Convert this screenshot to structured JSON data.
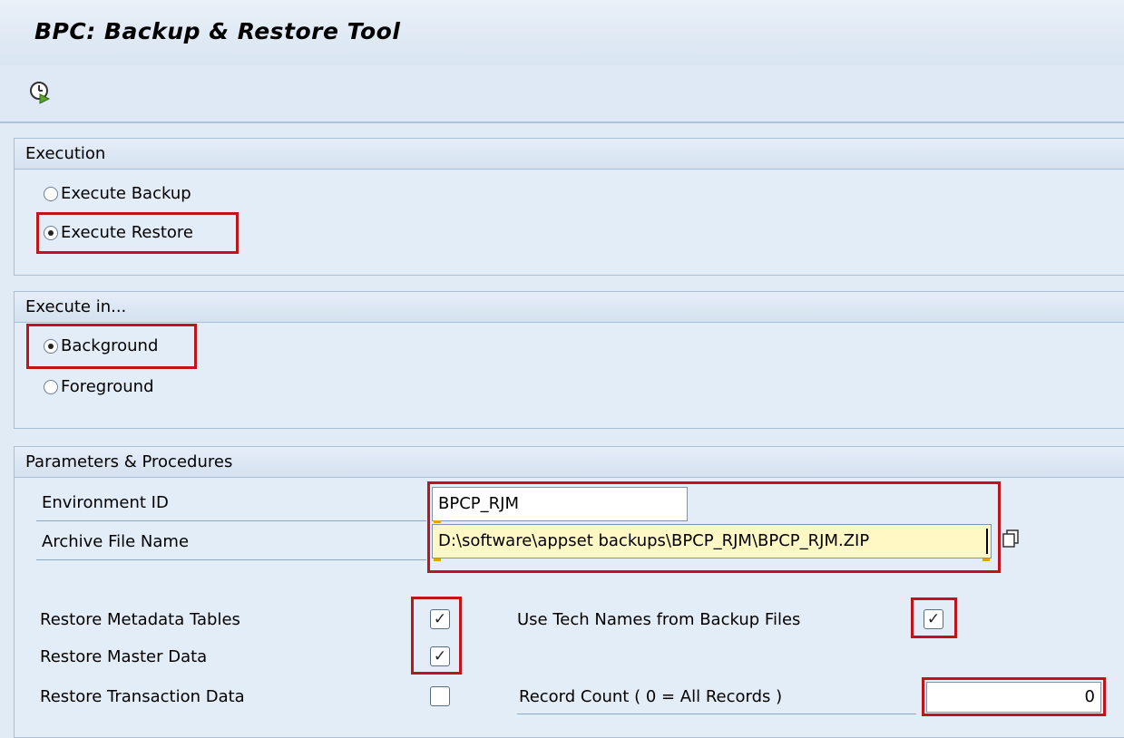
{
  "window": {
    "title": "BPC: Backup & Restore Tool"
  },
  "toolbar": {
    "execute_icon": "execute-clock-icon"
  },
  "execution": {
    "header": "Execution",
    "options": [
      {
        "label": "Execute Backup",
        "selected": false
      },
      {
        "label": "Execute Restore",
        "selected": true
      }
    ]
  },
  "execute_in": {
    "header": "Execute in...",
    "options": [
      {
        "label": "Background",
        "selected": true
      },
      {
        "label": "Foreground",
        "selected": false
      }
    ]
  },
  "params": {
    "header": "Parameters & Procedures",
    "environment_id": {
      "label": "Environment ID",
      "value": "BPCP_RJM"
    },
    "archive_file": {
      "label": "Archive File Name",
      "value": "D:\\software\\appset backups\\BPCP_RJM\\BPCP_RJM.ZIP"
    },
    "restore_metadata": {
      "label": "Restore Metadata Tables",
      "checked": true
    },
    "restore_master": {
      "label": "Restore Master Data",
      "checked": true
    },
    "restore_transaction": {
      "label": "Restore Transaction Data",
      "checked": false
    },
    "use_tech_names": {
      "label": "Use Tech Names from Backup Files",
      "checked": true
    },
    "record_count": {
      "label": "Record Count ( 0 =  All Records )",
      "value": "0"
    }
  },
  "colors": {
    "highlight": "#c0141b",
    "input_active": "#fff8c4",
    "panel_bg": "#e3edf8"
  }
}
